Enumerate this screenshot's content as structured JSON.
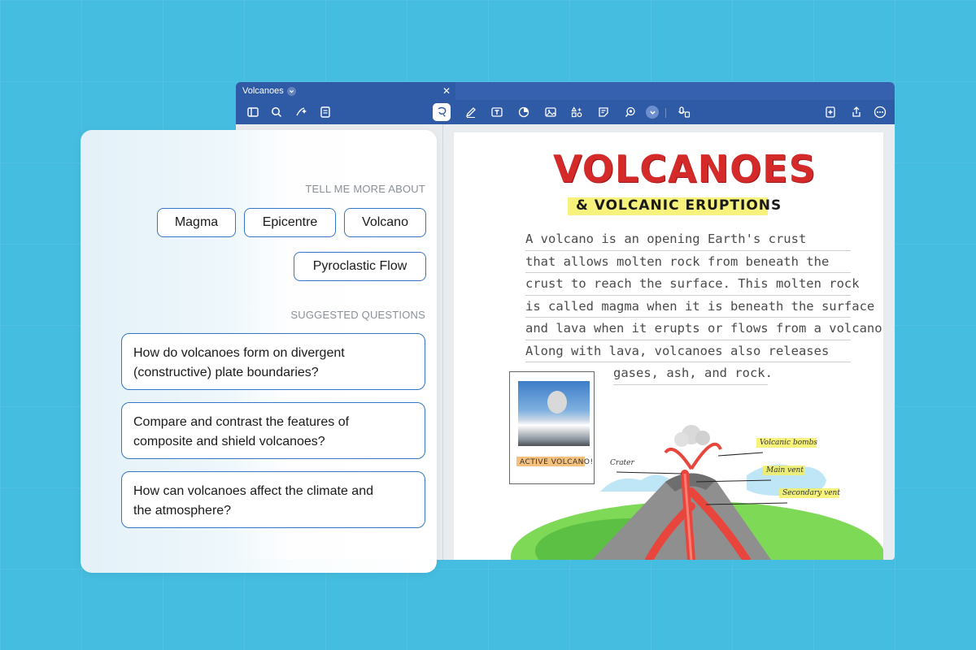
{
  "window": {
    "tab_title": "Volcanoes"
  },
  "toolbar": {
    "icons": [
      "sidebar-icon",
      "search-icon",
      "ai-sparkle-icon",
      "document-icon",
      "lasso-icon",
      "pen-icon",
      "text-box-icon",
      "shapes-icon",
      "image-icon",
      "elements-icon",
      "sticky-note-icon",
      "laser-pointer-icon",
      "chevron-down-icon",
      "audio-icon",
      "add-page-icon",
      "share-icon",
      "more-icon"
    ]
  },
  "panel": {
    "tell_me_label": "TELL ME MORE ABOUT",
    "topics": [
      "Magma",
      "Epicentre",
      "Volcano",
      "Pyroclastic Flow"
    ],
    "suggested_label": "SUGGESTED QUESTIONS",
    "questions": [
      {
        "line1": "How do volcanoes form on divergent",
        "line2": "(constructive) plate boundaries?"
      },
      {
        "line1": "Compare and contrast the features of",
        "line2": "composite and shield volcanoes?"
      },
      {
        "line1": "How can volcanoes affect the climate and",
        "line2": "the atmosphere?"
      }
    ]
  },
  "note": {
    "title": "VOLCANOES",
    "subtitle": "& VOLCANIC ERUPTIONS",
    "lines": [
      "A volcano is an opening Earth's crust",
      "that allows molten rock from beneath the",
      "crust to reach the surface. This molten rock",
      "is called magma when it is beneath the surface",
      "and lava when it erupts or flows from a volcano",
      "Along with lava, volcanoes also releases",
      "gases, ash, and rock."
    ],
    "photo_caption": "ACTIVE VOLCANO!",
    "labels": {
      "crater": "Crater",
      "bombs": "Volcanic bombs",
      "main_vent": "Main vent",
      "secondary_vent": "Secondary vent"
    }
  },
  "colors": {
    "background": "#45bde0",
    "toolbar": "#2f5aa5",
    "chip_border": "#3475c7",
    "title_red": "#d42a2a"
  }
}
